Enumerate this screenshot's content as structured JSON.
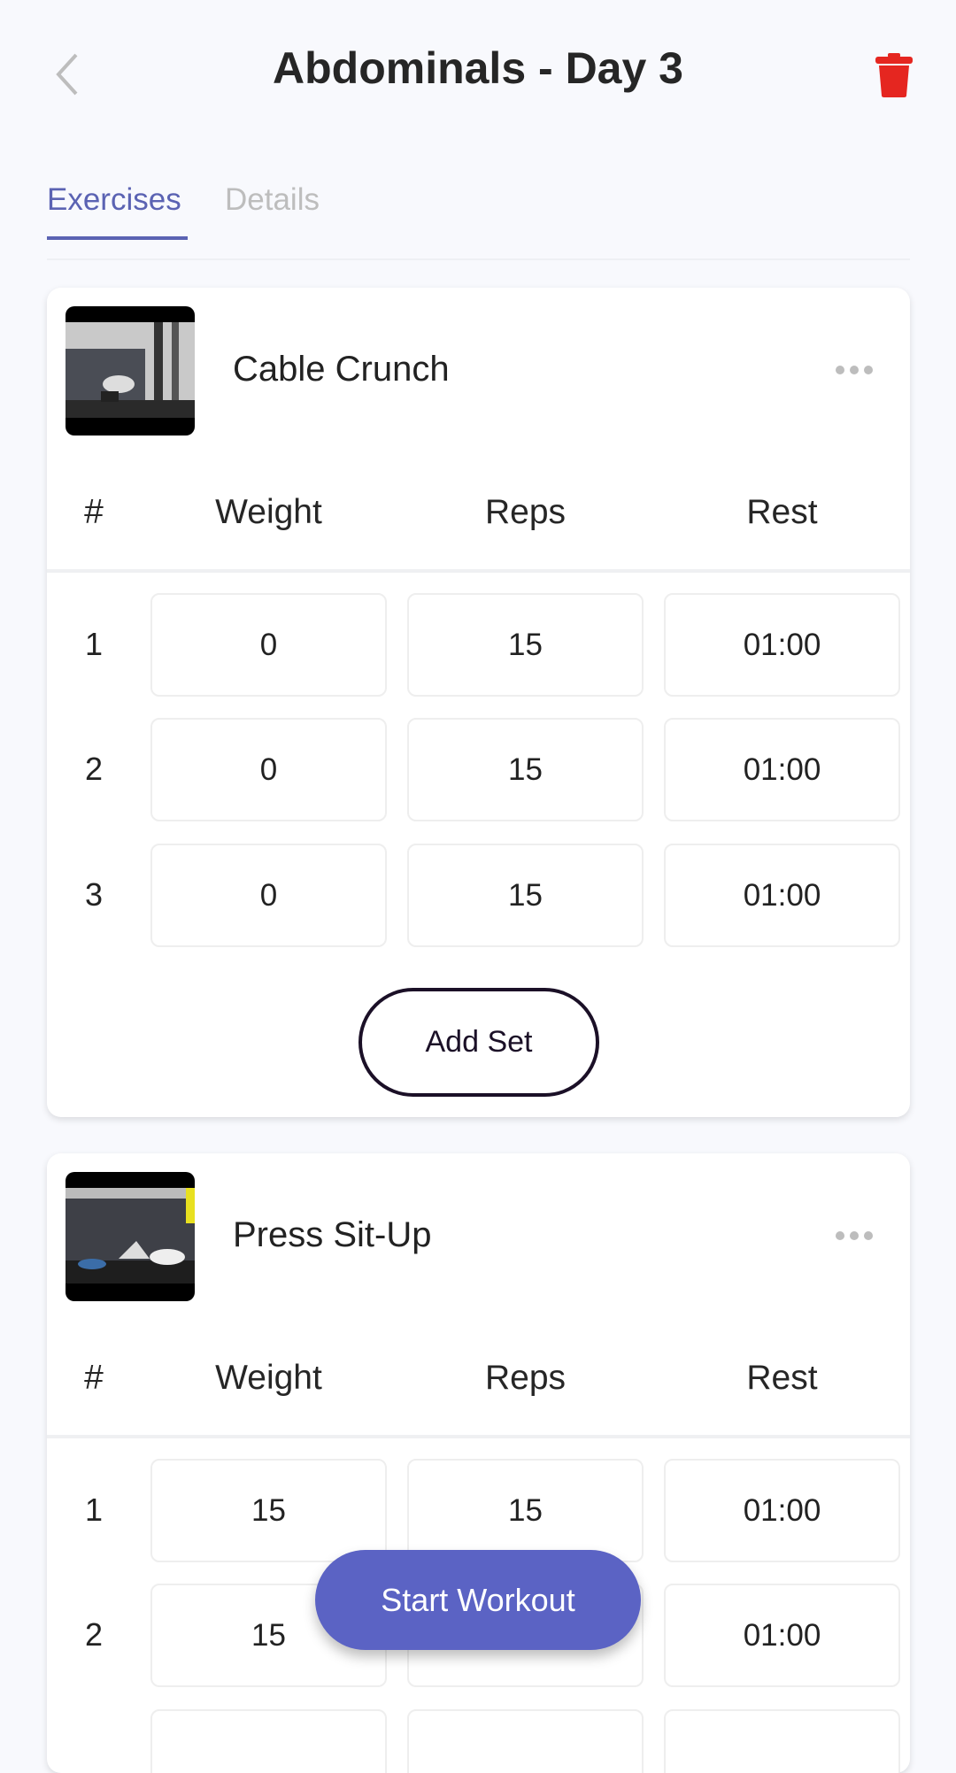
{
  "header": {
    "title": "Abdominals - Day 3",
    "back_icon": "chevron-left-icon",
    "delete_icon": "trash-icon",
    "delete_color": "#e52620"
  },
  "tabs": [
    {
      "label": "Exercises",
      "active": true
    },
    {
      "label": "Details",
      "active": false
    }
  ],
  "accent": "#5b63c4",
  "columns": [
    "#",
    "Weight",
    "Reps",
    "Rest"
  ],
  "exercises": [
    {
      "name": "Cable Crunch",
      "sets": [
        {
          "n": "1",
          "weight": "0",
          "reps": "15",
          "rest": "01:00"
        },
        {
          "n": "2",
          "weight": "0",
          "reps": "15",
          "rest": "01:00"
        },
        {
          "n": "3",
          "weight": "0",
          "reps": "15",
          "rest": "01:00"
        }
      ],
      "add_set_label": "Add Set"
    },
    {
      "name": "Press Sit-Up",
      "sets": [
        {
          "n": "1",
          "weight": "15",
          "reps": "15",
          "rest": "01:00"
        },
        {
          "n": "2",
          "weight": "15",
          "reps": "",
          "rest": "01:00"
        }
      ]
    }
  ],
  "start_workout_label": "Start Workout"
}
